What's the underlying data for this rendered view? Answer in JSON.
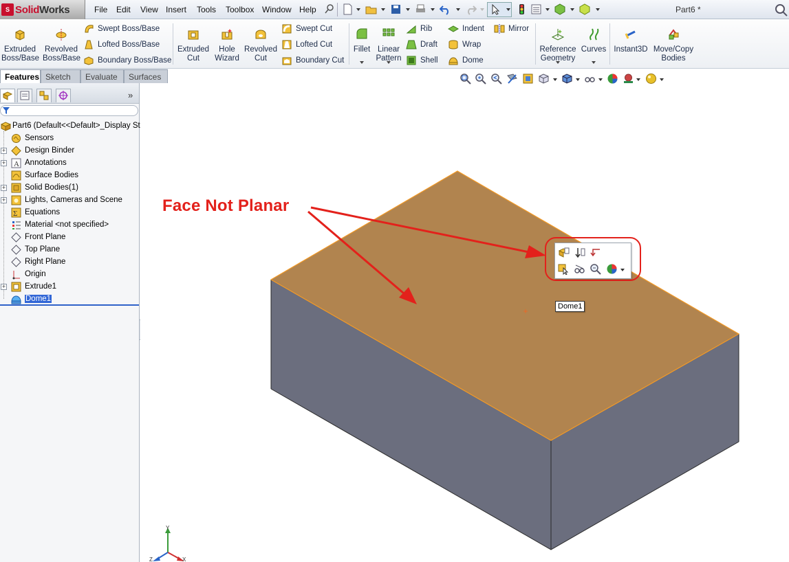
{
  "app": {
    "logo_prefix": "S",
    "logo_text": "Solid",
    "logo_text2": "Works",
    "doc_title": "Part6 *"
  },
  "menu": [
    "File",
    "Edit",
    "View",
    "Insert",
    "Tools",
    "Toolbox",
    "Window",
    "Help"
  ],
  "commands": {
    "extruded_boss": [
      "Extruded",
      "Boss/Base"
    ],
    "revolved_boss": [
      "Revolved",
      "Boss/Base"
    ],
    "swept_boss": "Swept Boss/Base",
    "lofted_boss": "Lofted Boss/Base",
    "boundary_boss": "Boundary Boss/Base",
    "extruded_cut": [
      "Extruded",
      "Cut"
    ],
    "hole_wizard": [
      "Hole",
      "Wizard"
    ],
    "revolved_cut": [
      "Revolved",
      "Cut"
    ],
    "swept_cut": "Swept Cut",
    "lofted_cut": "Lofted Cut",
    "boundary_cut": "Boundary Cut",
    "fillet": "Fillet",
    "linear_pattern": [
      "Linear",
      "Pattern"
    ],
    "rib": "Rib",
    "draft": "Draft",
    "shell": "Shell",
    "indent": "Indent",
    "wrap": "Wrap",
    "dome": "Dome",
    "mirror": "Mirror",
    "reference_geometry": [
      "Reference",
      "Geometry"
    ],
    "curves": "Curves",
    "instant3d": "Instant3D",
    "move_copy": [
      "Move/Copy",
      "Bodies"
    ]
  },
  "tabs": [
    {
      "label": "Features",
      "active": true
    },
    {
      "label": "Sketch",
      "active": false
    },
    {
      "label": "Evaluate",
      "active": false
    },
    {
      "label": "Surfaces",
      "active": false
    }
  ],
  "tree": {
    "root": "Part6  (Default<<Default>_Display St",
    "items": [
      {
        "label": "Sensors",
        "expandable": false,
        "icon": "sensor-icon"
      },
      {
        "label": "Design Binder",
        "expandable": true,
        "icon": "design-binder-icon"
      },
      {
        "label": "Annotations",
        "expandable": true,
        "icon": "annotations-icon"
      },
      {
        "label": "Surface Bodies",
        "expandable": false,
        "icon": "surface-bodies-icon"
      },
      {
        "label": "Solid Bodies(1)",
        "expandable": true,
        "icon": "solid-bodies-icon"
      },
      {
        "label": "Lights, Cameras and Scene",
        "expandable": true,
        "icon": "lights-icon"
      },
      {
        "label": "Equations",
        "expandable": false,
        "icon": "equations-icon"
      },
      {
        "label": "Material <not specified>",
        "expandable": false,
        "icon": "material-icon"
      },
      {
        "label": "Front Plane",
        "expandable": false,
        "icon": "plane-icon"
      },
      {
        "label": "Top Plane",
        "expandable": false,
        "icon": "plane-icon"
      },
      {
        "label": "Right Plane",
        "expandable": false,
        "icon": "plane-icon"
      },
      {
        "label": "Origin",
        "expandable": false,
        "icon": "origin-icon"
      },
      {
        "label": "Extrude1",
        "expandable": true,
        "icon": "extrude-icon"
      },
      {
        "label": "Dome1",
        "expandable": false,
        "icon": "dome-icon",
        "selected": true
      }
    ]
  },
  "viewport": {
    "callout": "Face Not Planar",
    "tooltip": "Dome1",
    "triad_labels": {
      "y": "Y",
      "x": "X",
      "z": "Z"
    }
  },
  "colors": {
    "top_face": "#b1844f",
    "side_face": "#6b6e7e",
    "highlight_edge": "#f39a26",
    "annotation_red": "#e3211b",
    "tree_selection": "#3166d6"
  }
}
